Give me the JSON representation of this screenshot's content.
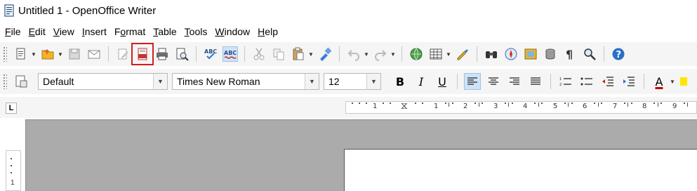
{
  "window": {
    "title": "Untitled 1 - OpenOffice Writer"
  },
  "menu": [
    {
      "label": "File",
      "name": "menu-file"
    },
    {
      "label": "Edit",
      "name": "menu-edit"
    },
    {
      "label": "View",
      "name": "menu-view"
    },
    {
      "label": "Insert",
      "name": "menu-insert"
    },
    {
      "label": "Format",
      "name": "menu-format"
    },
    {
      "label": "Table",
      "name": "menu-table"
    },
    {
      "label": "Tools",
      "name": "menu-tools"
    },
    {
      "label": "Window",
      "name": "menu-window"
    },
    {
      "label": "Help",
      "name": "menu-help"
    }
  ],
  "formatting": {
    "paragraph_style": "Default",
    "font_name": "Times New Roman",
    "font_size": "12"
  },
  "format_buttons": {
    "bold": "B",
    "italic": "I",
    "underline": "U",
    "font_color": "A"
  },
  "ruler": {
    "marks": [
      "1",
      "1",
      "2",
      "3",
      "4",
      "5",
      "6",
      "7",
      "8",
      "9"
    ],
    "vertical_mark": "1"
  },
  "highlight_color": "#d21f1f"
}
